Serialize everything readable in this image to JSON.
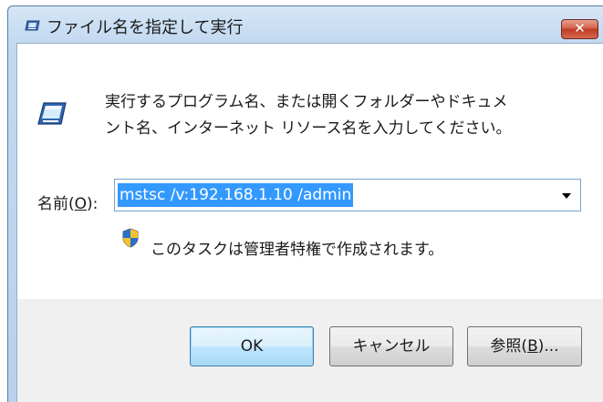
{
  "window": {
    "title": "ファイル名を指定して実行",
    "close_label": "✕"
  },
  "description": {
    "line1": "実行するプログラム名、または開くフォルダーやドキュメ",
    "line2": "ント名、インターネット リソース名を入力してください。"
  },
  "name_field": {
    "label_prefix": "名前(",
    "label_accel": "O",
    "label_suffix": "):",
    "value": "mstsc /v:192.168.1.10 /admin"
  },
  "admin_note": "このタスクは管理者特権で作成されます。",
  "buttons": {
    "ok": "OK",
    "cancel": "キャンセル",
    "browse_prefix": "参照(",
    "browse_accel": "B",
    "browse_suffix": ")..."
  },
  "colors": {
    "selection": "#3399ff",
    "close_button": "#c9452b",
    "ok_border": "#3c7fb1"
  },
  "icons": {
    "title": "run-dialog-icon",
    "main": "run-program-icon",
    "shield": "uac-shield-icon",
    "dropdown": "dropdown-arrow-icon"
  }
}
